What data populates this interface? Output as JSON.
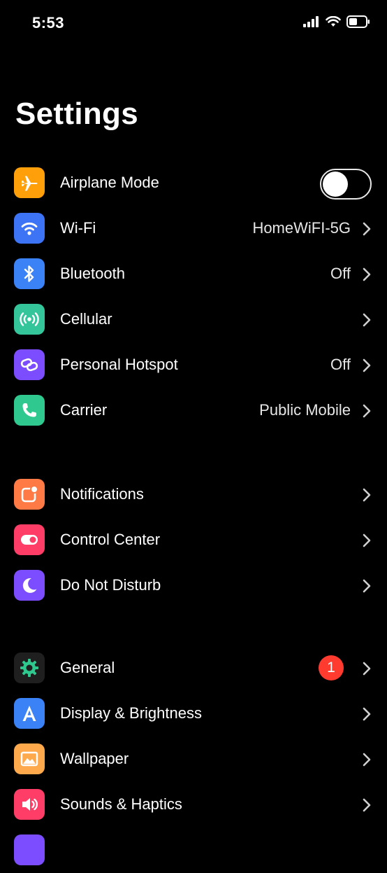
{
  "status": {
    "time": "5:53"
  },
  "title": "Settings",
  "groups": [
    {
      "rows": [
        {
          "label": "Airplane Mode",
          "icon": "airplane-icon",
          "color": "#ff9f0a",
          "toggle": false
        },
        {
          "label": "Wi-Fi",
          "icon": "wifi-icon",
          "color": "#3d73f5",
          "value": "HomeWiFI-5G"
        },
        {
          "label": "Bluetooth",
          "icon": "bluetooth-icon",
          "color": "#3b82f6",
          "value": "Off"
        },
        {
          "label": "Cellular",
          "icon": "cellular-icon",
          "color": "#34c59a"
        },
        {
          "label": "Personal Hotspot",
          "icon": "hotspot-icon",
          "color": "#7c4dff",
          "value": "Off"
        },
        {
          "label": "Carrier",
          "icon": "phone-icon",
          "color": "#2fc98f",
          "value": "Public Mobile"
        }
      ]
    },
    {
      "rows": [
        {
          "label": "Notifications",
          "icon": "notifications-icon",
          "color": "#ff7a45"
        },
        {
          "label": "Control Center",
          "icon": "control-center-icon",
          "color": "#ff3d67"
        },
        {
          "label": "Do Not Disturb",
          "icon": "moon-icon",
          "color": "#7c4dff"
        }
      ]
    },
    {
      "rows": [
        {
          "label": "General",
          "icon": "gear-icon",
          "color": "#1f1f1f",
          "badge": "1"
        },
        {
          "label": "Display & Brightness",
          "icon": "display-icon",
          "color": "#3b82f6"
        },
        {
          "label": "Wallpaper",
          "icon": "wallpaper-icon",
          "color": "#ffa94d"
        },
        {
          "label": "Sounds & Haptics",
          "icon": "speaker-icon",
          "color": "#ff3d67"
        }
      ]
    }
  ]
}
